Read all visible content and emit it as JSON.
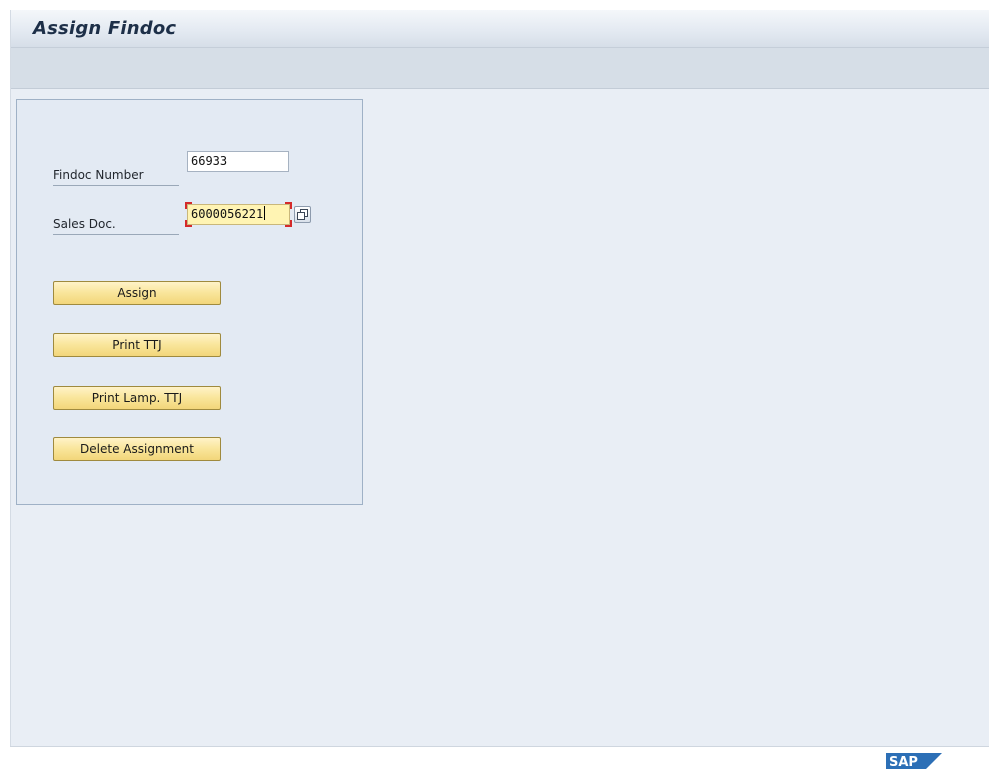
{
  "window": {
    "title": "Assign Findoc"
  },
  "form": {
    "findoc_number": {
      "label": "Findoc Number",
      "value": "66933"
    },
    "sales_doc": {
      "label": "Sales Doc.",
      "value": "6000056221"
    }
  },
  "buttons": {
    "assign": "Assign",
    "print_ttj": "Print TTJ",
    "print_lamp_ttj": "Print Lamp. TTJ",
    "delete_assignment": "Delete Assignment"
  },
  "footer": {
    "logo_text": "SAP",
    "logo_icon": "sap-logo-icon"
  },
  "colors": {
    "button_fill": "#f9e59a",
    "focused_field_fill": "#fff4b3",
    "background": "#e9eef5",
    "brand_blue": "#2c6fb6"
  }
}
